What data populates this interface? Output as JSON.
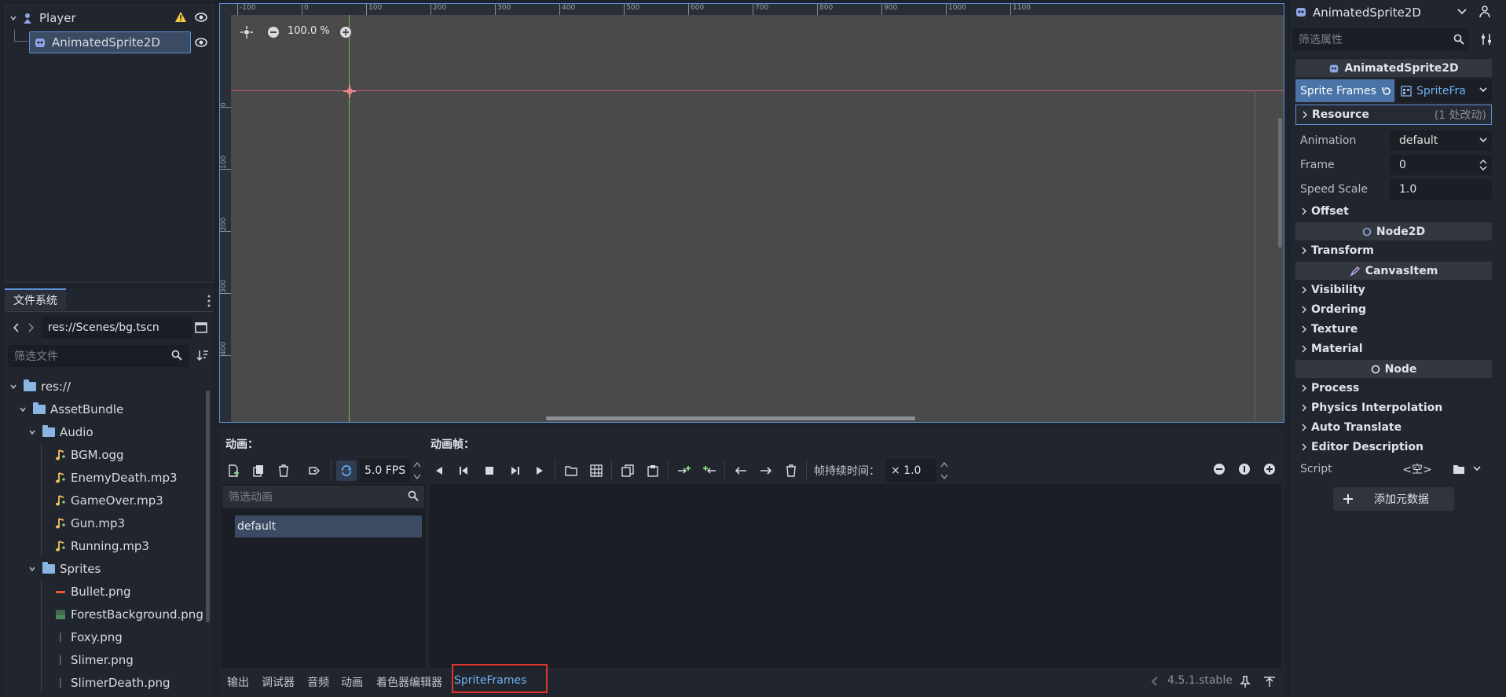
{
  "scene_tree": {
    "nodes": [
      {
        "label": "Player",
        "icon": "player-node-icon"
      },
      {
        "label": "AnimatedSprite2D",
        "icon": "animated-sprite-icon"
      }
    ]
  },
  "filesystem": {
    "tab_label": "文件系统",
    "path": "res://Scenes/bg.tscn",
    "filter_placeholder": "筛选文件",
    "items": [
      {
        "label": "res://",
        "type": "folder"
      },
      {
        "label": "AssetBundle",
        "type": "folder"
      },
      {
        "label": "Audio",
        "type": "folder"
      },
      {
        "label": "BGM.ogg",
        "type": "audio"
      },
      {
        "label": "EnemyDeath.mp3",
        "type": "audio"
      },
      {
        "label": "GameOver.mp3",
        "type": "audio"
      },
      {
        "label": "Gun.mp3",
        "type": "audio"
      },
      {
        "label": "Running.mp3",
        "type": "audio"
      },
      {
        "label": "Sprites",
        "type": "folder"
      },
      {
        "label": "Bullet.png",
        "type": "image"
      },
      {
        "label": "ForestBackground.png",
        "type": "image"
      },
      {
        "label": "Foxy.png",
        "type": "image"
      },
      {
        "label": "Slimer.png",
        "type": "image"
      },
      {
        "label": "SlimerDeath.png",
        "type": "image"
      }
    ]
  },
  "viewport": {
    "zoom": "100.0 %",
    "ruler_top": [
      "-100",
      "0",
      "100",
      "200",
      "300",
      "400",
      "500",
      "600",
      "700",
      "800",
      "900",
      "1000",
      "1100"
    ],
    "ruler_left": [
      "0",
      "100",
      "200",
      "300",
      "400"
    ]
  },
  "sprite_frames": {
    "animations_label": "动画：",
    "frames_label": "动画帧：",
    "fps": "5.0 FPS",
    "duration_label": "帧持续时间：",
    "duration_value": "× 1.0",
    "filter_placeholder": "筛选动画",
    "animations": [
      "default"
    ]
  },
  "bottom_tabs": [
    "输出",
    "调试器",
    "音频",
    "动画",
    "着色器编辑器",
    "SpriteFrames"
  ],
  "version": "4.5.1.stable",
  "inspector": {
    "node_name": "AnimatedSprite2D",
    "filter_placeholder": "筛选属性",
    "class_header": "AnimatedSprite2D",
    "sprite_frames_label": "Sprite Frames",
    "sprite_frames_value": "SpriteFra",
    "resource_label": "Resource",
    "resource_changes": "(1 处改动)",
    "props": [
      {
        "label": "Animation",
        "value": "default"
      },
      {
        "label": "Frame",
        "value": "0"
      },
      {
        "label": "Speed Scale",
        "value": "1.0"
      }
    ],
    "offset_label": "Offset",
    "node2d_label": "Node2D",
    "transform_label": "Transform",
    "canvasitem_label": "CanvasItem",
    "canvas_sections": [
      "Visibility",
      "Ordering",
      "Texture",
      "Material"
    ],
    "node_label": "Node",
    "node_sections": [
      "Process",
      "Physics Interpolation",
      "Auto Translate",
      "Editor Description"
    ],
    "script_label": "Script",
    "script_value": "<空>",
    "add_metadata": "添加元数据"
  },
  "colors": {
    "accent": "#5a92d6",
    "highlight_tab": "#e0322f",
    "bg": "#21252d"
  }
}
